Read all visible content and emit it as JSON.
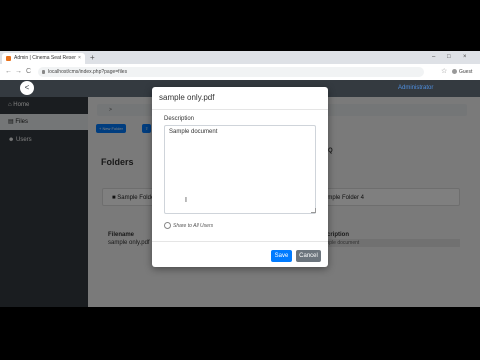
{
  "browser": {
    "tab_title": "Admin | Cinema Seat Reservation",
    "tab_close": "×",
    "new_tab": "+",
    "minimize": "–",
    "maximize": "□",
    "close": "×",
    "back": "←",
    "forward": "→",
    "reload": "C",
    "url": "localhost/cms/index.php?page=files",
    "bookmark": "☆",
    "profile": "Guest"
  },
  "app": {
    "logo_glyph": "<",
    "top_right_link": "Administrator",
    "breadcrumb": ">",
    "new_folder": "+ New Folder",
    "sidebar": [
      {
        "label": "Home",
        "icon": "home-icon"
      },
      {
        "label": "Files",
        "icon": "file-icon"
      },
      {
        "label": "Users",
        "icon": "users-icon"
      }
    ],
    "folders_heading": "Folders",
    "search_icon_glyph": "Q",
    "folders": [
      "Sample Folder",
      "Sample Folder 4"
    ],
    "table": {
      "headers": [
        "Filename",
        "Description"
      ],
      "rows": [
        {
          "filename": "sample only.pdf",
          "description": "Sample document"
        }
      ]
    }
  },
  "modal": {
    "title": "sample only.pdf",
    "description_label": "Description",
    "description_value": "Sample document",
    "text_cursor": "I",
    "share_label": "Share to All Users",
    "save_label": "Save",
    "cancel_label": "Cancel"
  },
  "colors": {
    "primary": "#007bff",
    "secondary": "#6c757d",
    "dark": "#343a40"
  }
}
